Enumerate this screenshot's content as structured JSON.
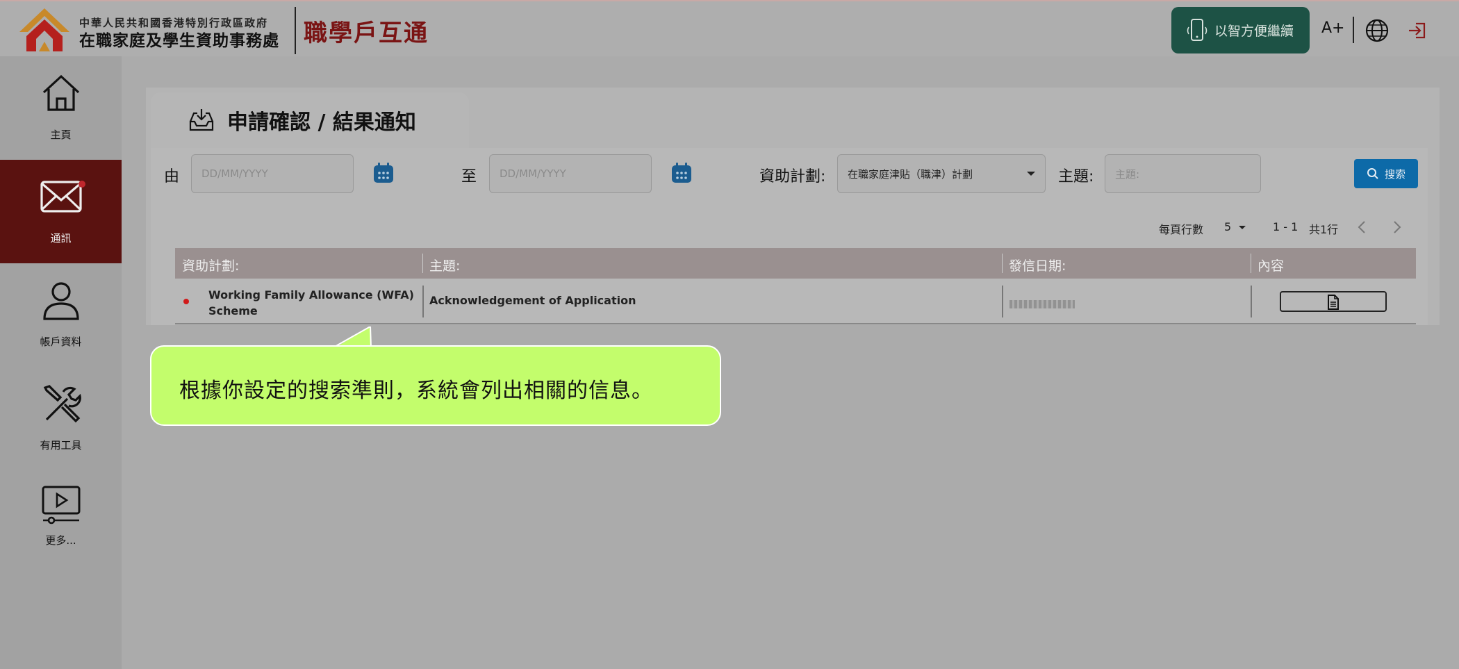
{
  "header": {
    "org_small": "中華人民共和國香港特別行政區政府",
    "org_big": "在職家庭及學生資助事務處",
    "brand": "職學戶互通",
    "gov_button": "以智方便繼續",
    "font_size": "A+",
    "globe_icon": "globe-icon",
    "logout_icon": "logout-icon"
  },
  "sidebar": {
    "items": [
      {
        "label": "主頁",
        "icon": "home-icon"
      },
      {
        "label": "通訊",
        "icon": "mail-icon"
      },
      {
        "label": "帳戶資料",
        "icon": "user-icon"
      },
      {
        "label": "有用工具",
        "icon": "tools-icon"
      },
      {
        "label": "更多...",
        "icon": "video-icon"
      }
    ]
  },
  "main": {
    "tab_title": "申請確認 / 結果通知",
    "filters": {
      "from_label": "由",
      "from_placeholder": "DD/MM/YYYY",
      "to_label": "至",
      "to_placeholder": "DD/MM/YYYY",
      "scheme_label": "資助計劃:",
      "scheme_value": "在職家庭津貼（職津）計劃",
      "subject_label": "主題:",
      "subject_placeholder": "主題:",
      "search_button": "搜索"
    },
    "pager": {
      "rows_per_page_label": "每頁行數",
      "rows_per_page": "5",
      "range": "1 - 1",
      "total": "共1行"
    },
    "table": {
      "headers": [
        "資助計劃:",
        "主題:",
        "發信日期:",
        "內容"
      ],
      "rows": [
        {
          "scheme_line1": "Working Family Allowance (WFA)",
          "scheme_line2": "Scheme",
          "subject": "Acknowledgement of Application",
          "date": ""
        }
      ]
    }
  },
  "callout": {
    "text": "根據你設定的搜索準則，系統會列出相關的信息。"
  }
}
